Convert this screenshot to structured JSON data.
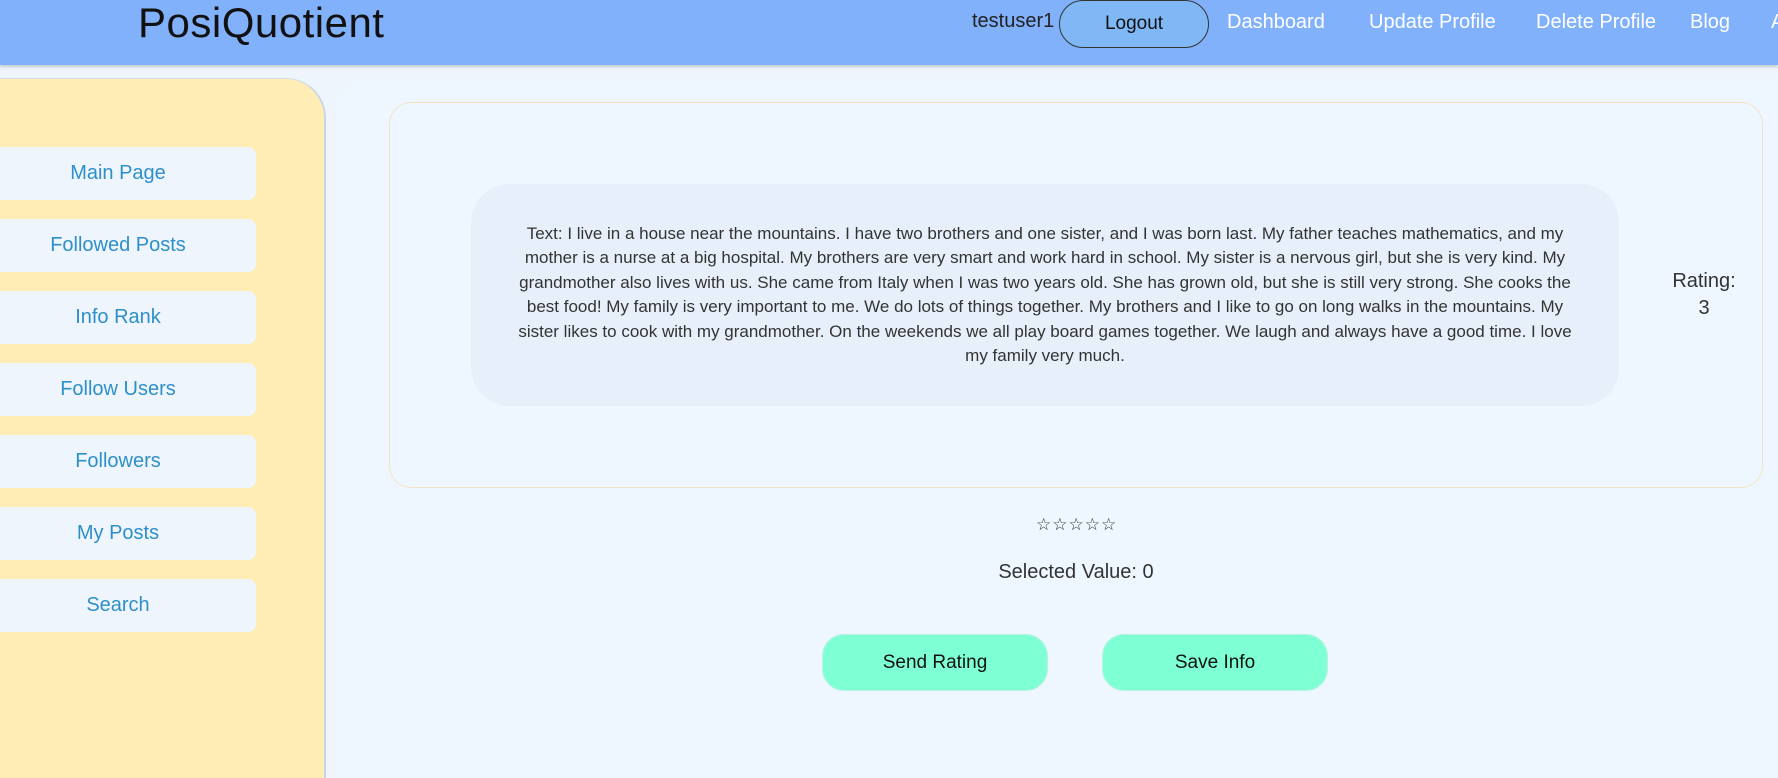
{
  "header": {
    "brand": "PosiQuotient",
    "username": "testuser1",
    "logout_label": "Logout",
    "nav_links": [
      "Dashboard",
      "Update Profile",
      "Delete Profile",
      "Blog",
      "A"
    ]
  },
  "sidebar": {
    "items": [
      {
        "label": "Main Page"
      },
      {
        "label": "Followed Posts"
      },
      {
        "label": "Info Rank"
      },
      {
        "label": "Follow Users"
      },
      {
        "label": "Followers"
      },
      {
        "label": "My Posts"
      },
      {
        "label": "Search"
      }
    ]
  },
  "post": {
    "text": "Text: I live in a house near the mountains. I have two brothers and one sister, and I was born last. My father teaches mathematics, and my mother is a nurse at a big hospital. My brothers are very smart and work hard in school. My sister is a nervous girl, but she is very kind. My grandmother also lives with us. She came from Italy when I was two years old. She has grown old, but she is still very strong. She cooks the best food! My family is very important to me. We do lots of things together. My brothers and I like to go on long walks in the mountains. My sister likes to cook with my grandmother. On the weekends we all play board games together. We laugh and always have a good time. I love my family very much.",
    "rating_label": "Rating:",
    "rating_value": "3"
  },
  "rating_widget": {
    "stars": "☆☆☆☆☆",
    "star_count": 5,
    "selected_text": "Selected Value: 0"
  },
  "actions": {
    "send_rating_label": "Send Rating",
    "save_info_label": "Save Info"
  },
  "colors": {
    "header_bg": "#82b1fc",
    "sidebar_bg": "#ffedb5",
    "main_bg": "#eef7ff",
    "action_button_bg": "#7fffd4",
    "sidebar_link": "#2e8fc9",
    "logout_bg": "#7fb8f5"
  }
}
